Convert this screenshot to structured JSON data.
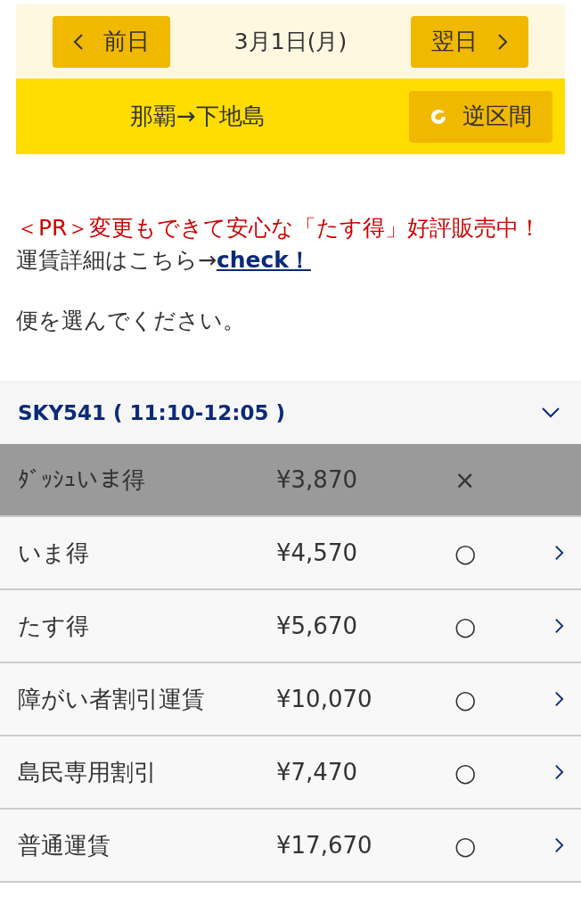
{
  "date_nav": {
    "prev_label": "前日",
    "date": "3月1日(月)",
    "next_label": "翌日"
  },
  "route": {
    "text": "那覇→下地島",
    "reverse_label": "逆区間"
  },
  "notice": {
    "pr": "＜PR＞変更もできて安心な「たす得」好評販売中！",
    "detail_text": "運賃詳細はこちら→",
    "detail_link": "check！"
  },
  "instruction": "便を選んでください。",
  "flight": {
    "title": "SKY541 ( 11:10-12:05 )",
    "expanded": true,
    "fares": [
      {
        "name": "ﾀﾞｯｼｭいま得",
        "price": "¥3,870",
        "availability": "×",
        "disabled": true
      },
      {
        "name": "いま得",
        "price": "¥4,570",
        "availability": "○",
        "disabled": false
      },
      {
        "name": "たす得",
        "price": "¥5,670",
        "availability": "○",
        "disabled": false
      },
      {
        "name": "障がい者割引運賃",
        "price": "¥10,070",
        "availability": "○",
        "disabled": false
      },
      {
        "name": "島民専用割引",
        "price": "¥7,470",
        "availability": "○",
        "disabled": false
      },
      {
        "name": "普通運賃",
        "price": "¥17,670",
        "availability": "○",
        "disabled": false
      }
    ]
  }
}
